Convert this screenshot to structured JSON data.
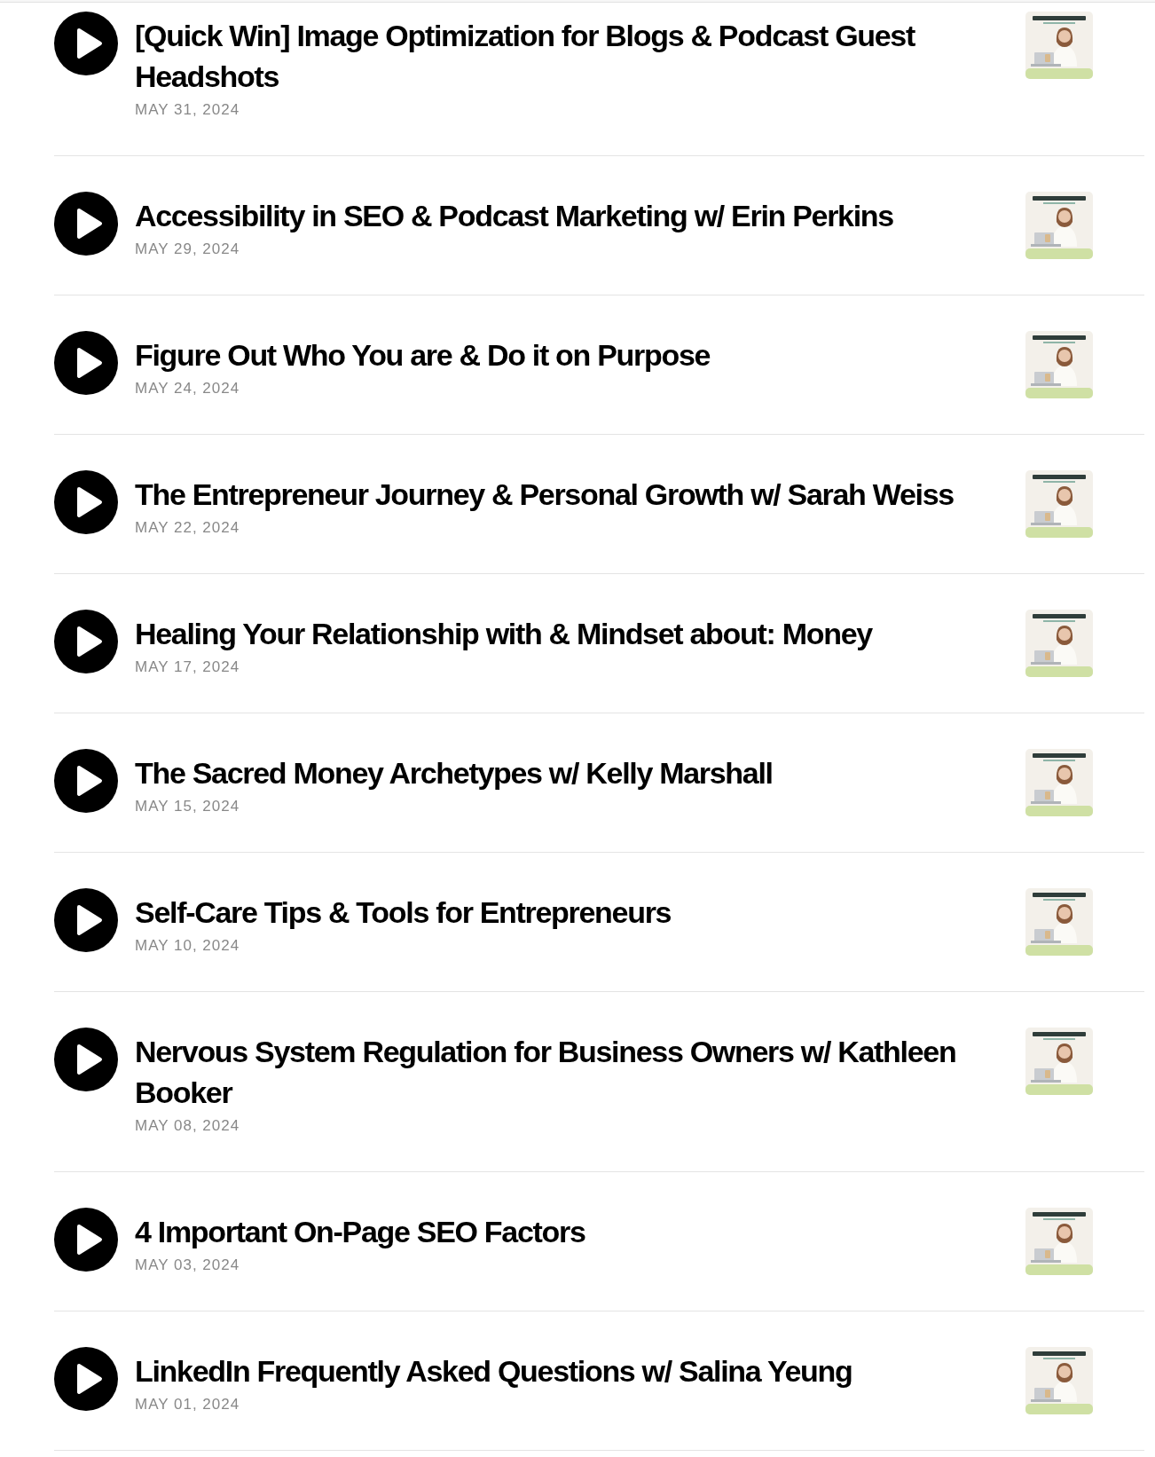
{
  "episodes": [
    {
      "title": "[Quick Win] Image Optimization for Blogs & Podcast Guest Headshots",
      "date": "MAY 31, 2024"
    },
    {
      "title": "Accessibility in SEO & Podcast Marketing w/ Erin Perkins",
      "date": "MAY 29, 2024"
    },
    {
      "title": "Figure Out Who You are & Do it on Purpose",
      "date": "MAY 24, 2024"
    },
    {
      "title": "The Entrepreneur Journey & Personal Growth w/ Sarah Weiss",
      "date": "MAY 22, 2024"
    },
    {
      "title": "Healing Your Relationship with & Mindset about: Money",
      "date": "MAY 17, 2024"
    },
    {
      "title": "The Sacred Money Archetypes w/ Kelly Marshall",
      "date": "MAY 15, 2024"
    },
    {
      "title": "Self-Care Tips & Tools for Entrepreneurs",
      "date": "MAY 10, 2024"
    },
    {
      "title": "Nervous System Regulation for Business Owners w/ Kathleen Booker",
      "date": "MAY 08, 2024"
    },
    {
      "title": "4 Important On-Page SEO Factors",
      "date": "MAY 03, 2024"
    },
    {
      "title": "LinkedIn Frequently Asked Questions w/ Salina Yeung",
      "date": "MAY 01, 2024"
    }
  ]
}
